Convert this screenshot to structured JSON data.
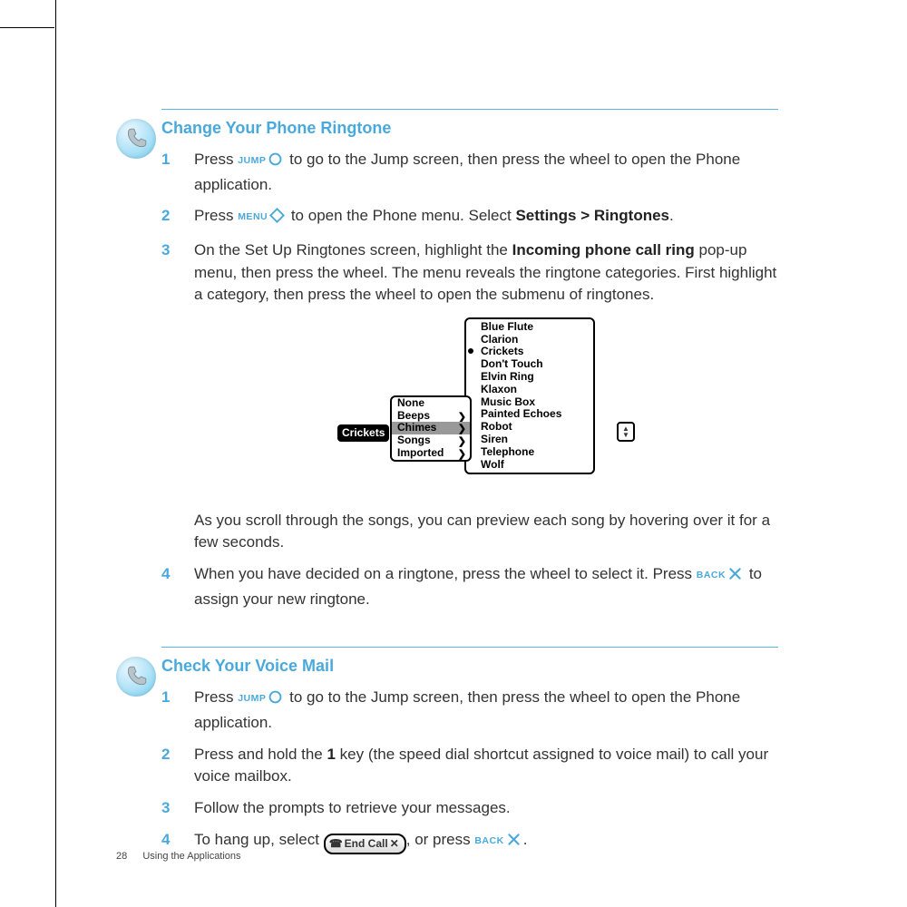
{
  "footer": {
    "page_number": "28",
    "section": "Using the Applications"
  },
  "section_a": {
    "heading": "Change Your Phone Ringtone",
    "step1_num": "1",
    "step1_a": "Press ",
    "step1_jump": "JUMP",
    "step1_b": " to go to the Jump screen, then press the wheel to open the Phone application.",
    "step2_num": "2",
    "step2_a": "Press ",
    "step2_menu": "MENU",
    "step2_b": " to open the Phone menu. Select ",
    "step2_bold": "Settings > Ringtones",
    "step2_c": ".",
    "step3_num": "3",
    "step3_a": "On the Set Up Ringtones screen, highlight the ",
    "step3_bold": "Incoming phone call ring",
    "step3_b": " pop-up menu, then press the wheel. The menu reveals the ringtone categories. First highlight a category, then press the wheel to open the submenu of ringtones.",
    "step3_after": "As you scroll through the songs, you can preview each song by hovering over it for a few seconds.",
    "step4_num": "4",
    "step4_a": "When you have decided on a ringtone, press the wheel to select it. Press ",
    "step4_back": "BACK",
    "step4_b": " to assign your new ringtone."
  },
  "menu_graphic": {
    "tag": "Crickets",
    "categories": [
      "None",
      "Beeps",
      "Chimes",
      "Songs",
      "Imported"
    ],
    "categories_selected_index": 2,
    "songs": [
      "Blue Flute",
      "Clarion",
      "Crickets",
      "Don't Touch",
      "Elvin Ring",
      "Klaxon",
      "Music Box",
      "Painted Echoes",
      "Robot",
      "Siren",
      "Telephone",
      "Wolf"
    ],
    "songs_bullet_index": 2
  },
  "section_b": {
    "heading": "Check Your Voice Mail",
    "step1_num": "1",
    "step1_a": "Press ",
    "step1_jump": "JUMP",
    "step1_b": " to go to the Jump screen, then press the wheel to open the Phone application.",
    "step2_num": "2",
    "step2_a": "Press and hold the ",
    "step2_bold": "1",
    "step2_b": " key (the speed dial shortcut assigned to voice mail) to call your voice mailbox.",
    "step3_num": "3",
    "step3_a": "Follow the prompts to retrieve your messages.",
    "step4_num": "4",
    "step4_a": "To hang up, select ",
    "step4_endcall": "End Call",
    "step4_b": ", or press ",
    "step4_back": "BACK",
    "step4_c": "."
  }
}
